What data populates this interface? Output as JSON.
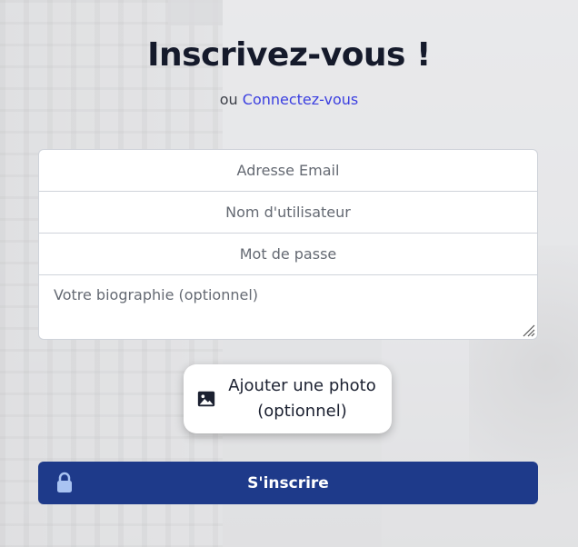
{
  "page": {
    "title": "Inscrivez-vous !",
    "subtitle_prefix": "ou",
    "login_link": "Connectez-vous"
  },
  "form": {
    "email_placeholder": "Adresse Email",
    "username_placeholder": "Nom d'utilisateur",
    "password_placeholder": "Mot de passe",
    "bio_placeholder": "Votre biographie (optionnel)"
  },
  "photo_button": {
    "label_line1": "Ajouter une photo",
    "label_line2": "(optionnel)",
    "icon": "image-icon"
  },
  "submit_button": {
    "label": "S'inscrire",
    "icon": "lock-icon"
  },
  "colors": {
    "primary": "#1e3a8a",
    "link": "#3b3fe0",
    "title": "#151a2b"
  }
}
